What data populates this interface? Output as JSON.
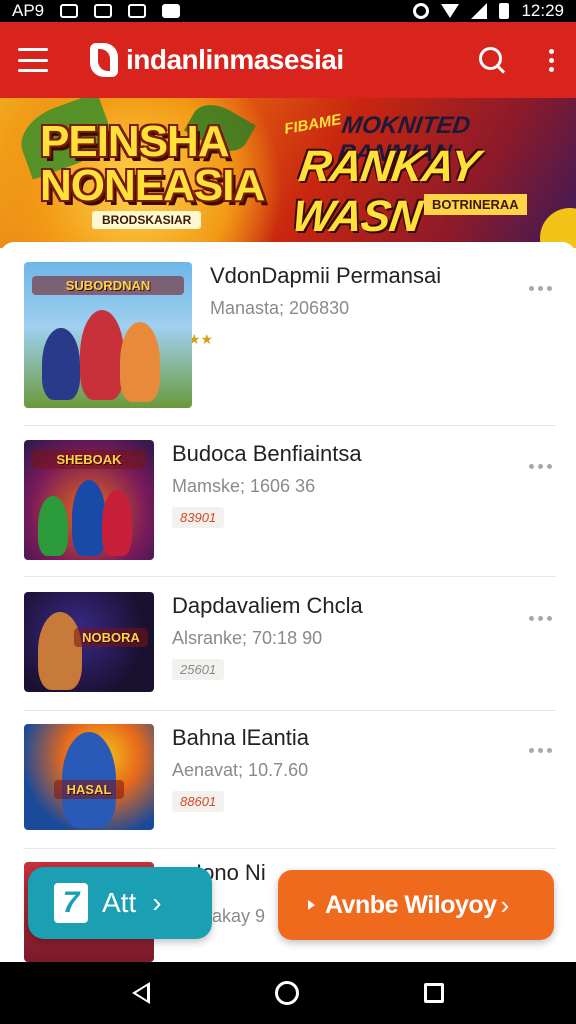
{
  "status_bar": {
    "carrier": "AP9",
    "time": "12:29"
  },
  "app_bar": {
    "title": "indanlinmasesiai"
  },
  "banner": {
    "left_title": "PEINSHA NONEASIA",
    "left_sub": "BRODSKASIAR",
    "right_line1": "MOKNITED RANMIAN",
    "right_line2": "RANKAY WASN",
    "right_badge": "BOTRINERAA",
    "tag": "FIBAME"
  },
  "list": {
    "items": [
      {
        "title": "VdonDapmii Permansai",
        "subtitle": "Manasta; 206830",
        "badge": "",
        "thumb_word": "SUBORDNAN"
      },
      {
        "title": "Budoca Benfiaintsa",
        "subtitle": "Mamske; 1606 36",
        "badge": "83901",
        "thumb_word": "SHEBOAK"
      },
      {
        "title": "Dapdavaliem Chcla",
        "subtitle": "Alsranke; 70:18 90",
        "badge": "25601",
        "thumb_word": "NOBORA"
      },
      {
        "title": "Bahna lEantia",
        "subtitle": "Aenavat; 10.7.60",
        "badge": "88601",
        "thumb_word": "HASAL"
      }
    ],
    "peek_title": "Iono Ni",
    "peek_subtitle": "akay 9"
  },
  "fab_left": {
    "icon_char": "7",
    "label": "Att",
    "chevron": "›"
  },
  "fab_right": {
    "label": "Avnbe Wiloyoy",
    "chevron": "›"
  },
  "colors": {
    "brand_red": "#d9231d",
    "teal": "#1a9fb3",
    "orange": "#f06a1e"
  }
}
